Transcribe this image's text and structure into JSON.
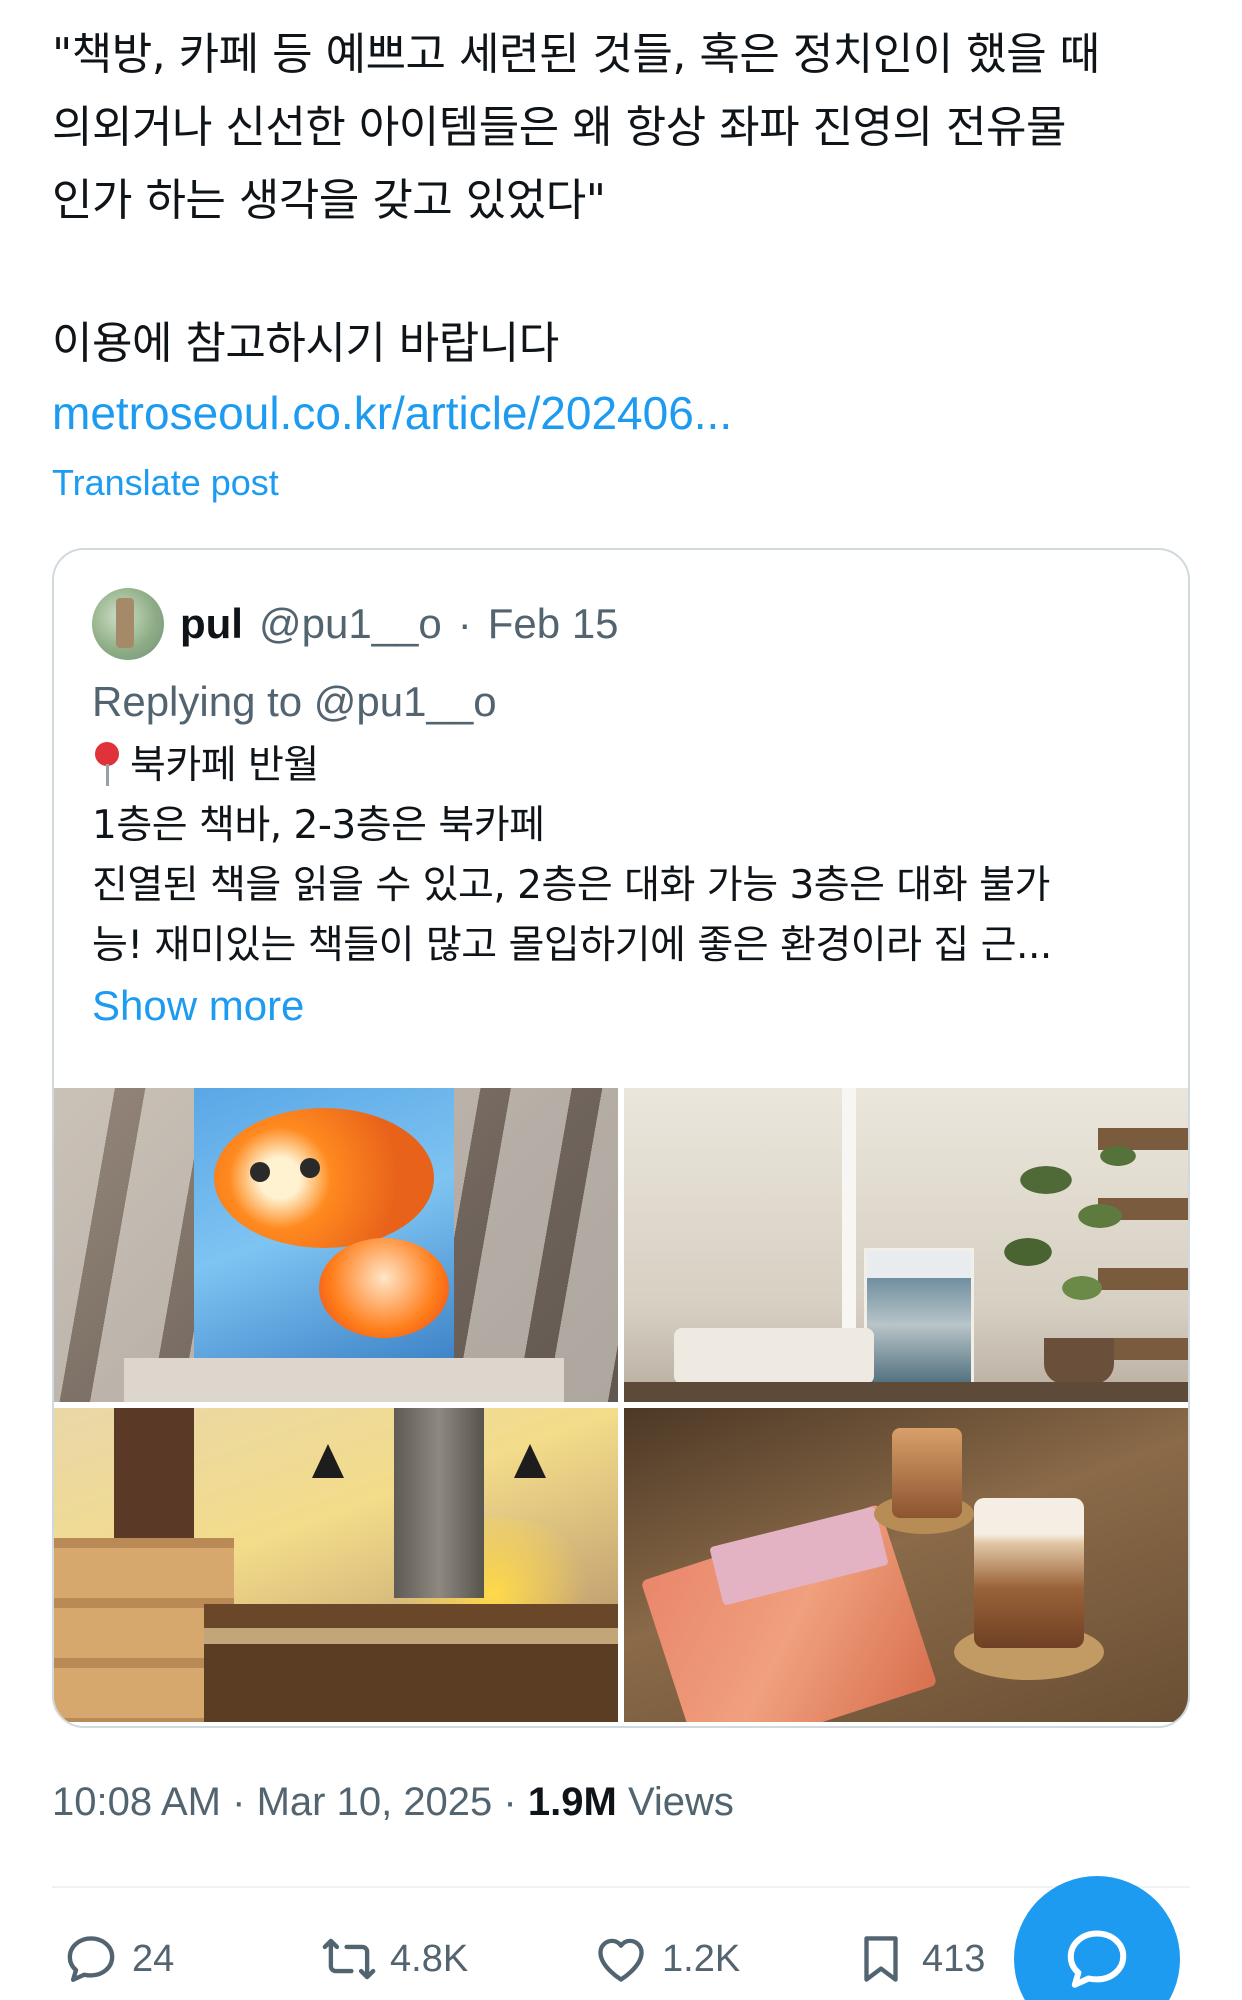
{
  "tweet": {
    "lines": [
      "\"책방, 카페 등 예쁘고 세련된 것들, 혹은 정치인이 했을 때",
      "의외거나 신선한 아이템들은 왜 항상 좌파 진영의 전유물",
      "인가 하는 생각을 갖고 있었다\"",
      "이용에 참고하시기 바랍니다"
    ],
    "link": "metroseoul.co.kr/article/202406...",
    "translate": "Translate post"
  },
  "quote": {
    "name": "pul",
    "handle": "@pu1__o",
    "date": "Feb 15",
    "separator": "·",
    "replying_prefix": "Replying to",
    "replying_handle": "@pu1__o",
    "body": [
      "북카페 반월",
      "1층은 책바, 2-3층은 북카페",
      "진열된 책을 읽을 수 있고, 2층은 대화 가능 3층은 대화 불가",
      "능! 재미있는 책들이 많고 몰입하기에 좋은 환경이라 집 근..."
    ],
    "show_more": "Show more"
  },
  "meta": {
    "time": "10:08 AM",
    "date": "Mar 10, 2025",
    "separator": "·",
    "views_count": "1.9M",
    "views_label": "Views"
  },
  "actions": {
    "replies": "24",
    "reposts": "4.8K",
    "likes": "1.2K",
    "bookmarks": "413"
  },
  "colors": {
    "accent": "#1d9bf0",
    "secondary_text": "#536471",
    "border": "#cfd9de"
  }
}
